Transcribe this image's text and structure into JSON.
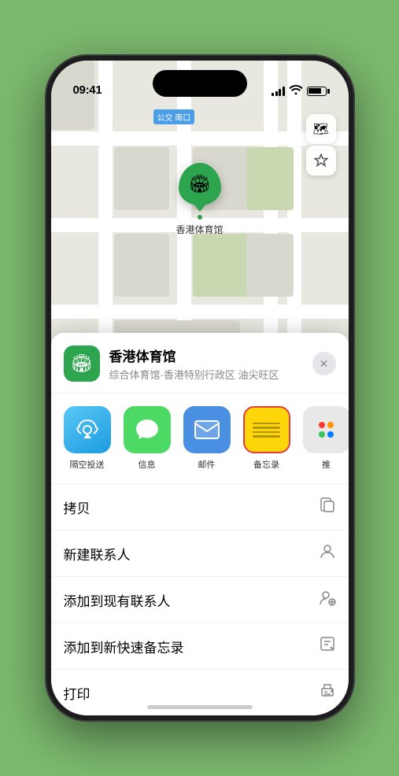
{
  "status_bar": {
    "time": "09:41",
    "location_icon": "▶"
  },
  "map": {
    "label": "南口",
    "label_prefix": "公交"
  },
  "map_controls": {
    "map_icon": "🗺",
    "location_icon": "⬆"
  },
  "marker": {
    "name": "香港体育馆",
    "icon": "🏟"
  },
  "sheet": {
    "venue_name": "香港体育馆",
    "venue_desc": "综合体育馆·香港特别行政区 油尖旺区",
    "close_label": "✕"
  },
  "share_items": [
    {
      "id": "airdrop",
      "label": "隔空投送",
      "type": "airdrop"
    },
    {
      "id": "messages",
      "label": "信息",
      "type": "messages"
    },
    {
      "id": "mail",
      "label": "邮件",
      "type": "mail"
    },
    {
      "id": "notes",
      "label": "备忘录",
      "type": "notes"
    },
    {
      "id": "more",
      "label": "推",
      "type": "more"
    }
  ],
  "actions": [
    {
      "label": "拷贝",
      "icon": "⎘"
    },
    {
      "label": "新建联系人",
      "icon": "👤"
    },
    {
      "label": "添加到现有联系人",
      "icon": "➕"
    },
    {
      "label": "添加到新快速备忘录",
      "icon": "📋"
    },
    {
      "label": "打印",
      "icon": "🖨"
    }
  ]
}
